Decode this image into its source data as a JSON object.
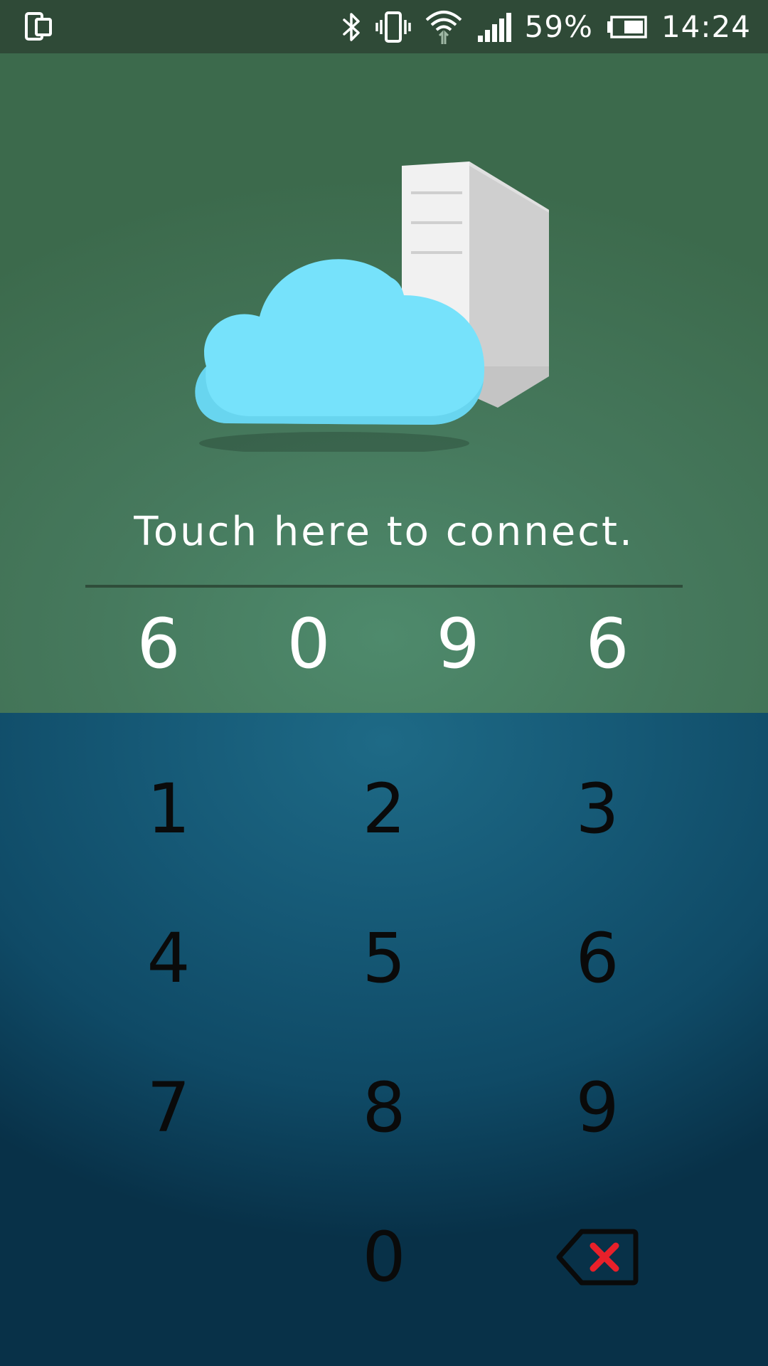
{
  "status_bar": {
    "battery_percent": "59%",
    "time": "14:24",
    "icons": [
      "screen-mirror-icon",
      "bluetooth-icon",
      "vibrate-icon",
      "wifi-icon",
      "signal-icon",
      "battery-icon"
    ]
  },
  "connect": {
    "label": "Touch here to connect."
  },
  "code": {
    "digits": [
      "6",
      "0",
      "9",
      "6"
    ]
  },
  "keypad": {
    "keys": [
      "1",
      "2",
      "3",
      "4",
      "5",
      "6",
      "7",
      "8",
      "9",
      "0"
    ],
    "backspace_icon": "backspace-icon"
  },
  "colors": {
    "top_panel": "#46795d",
    "keypad_panel": "#165a77",
    "backspace_x": "#e8202a"
  }
}
